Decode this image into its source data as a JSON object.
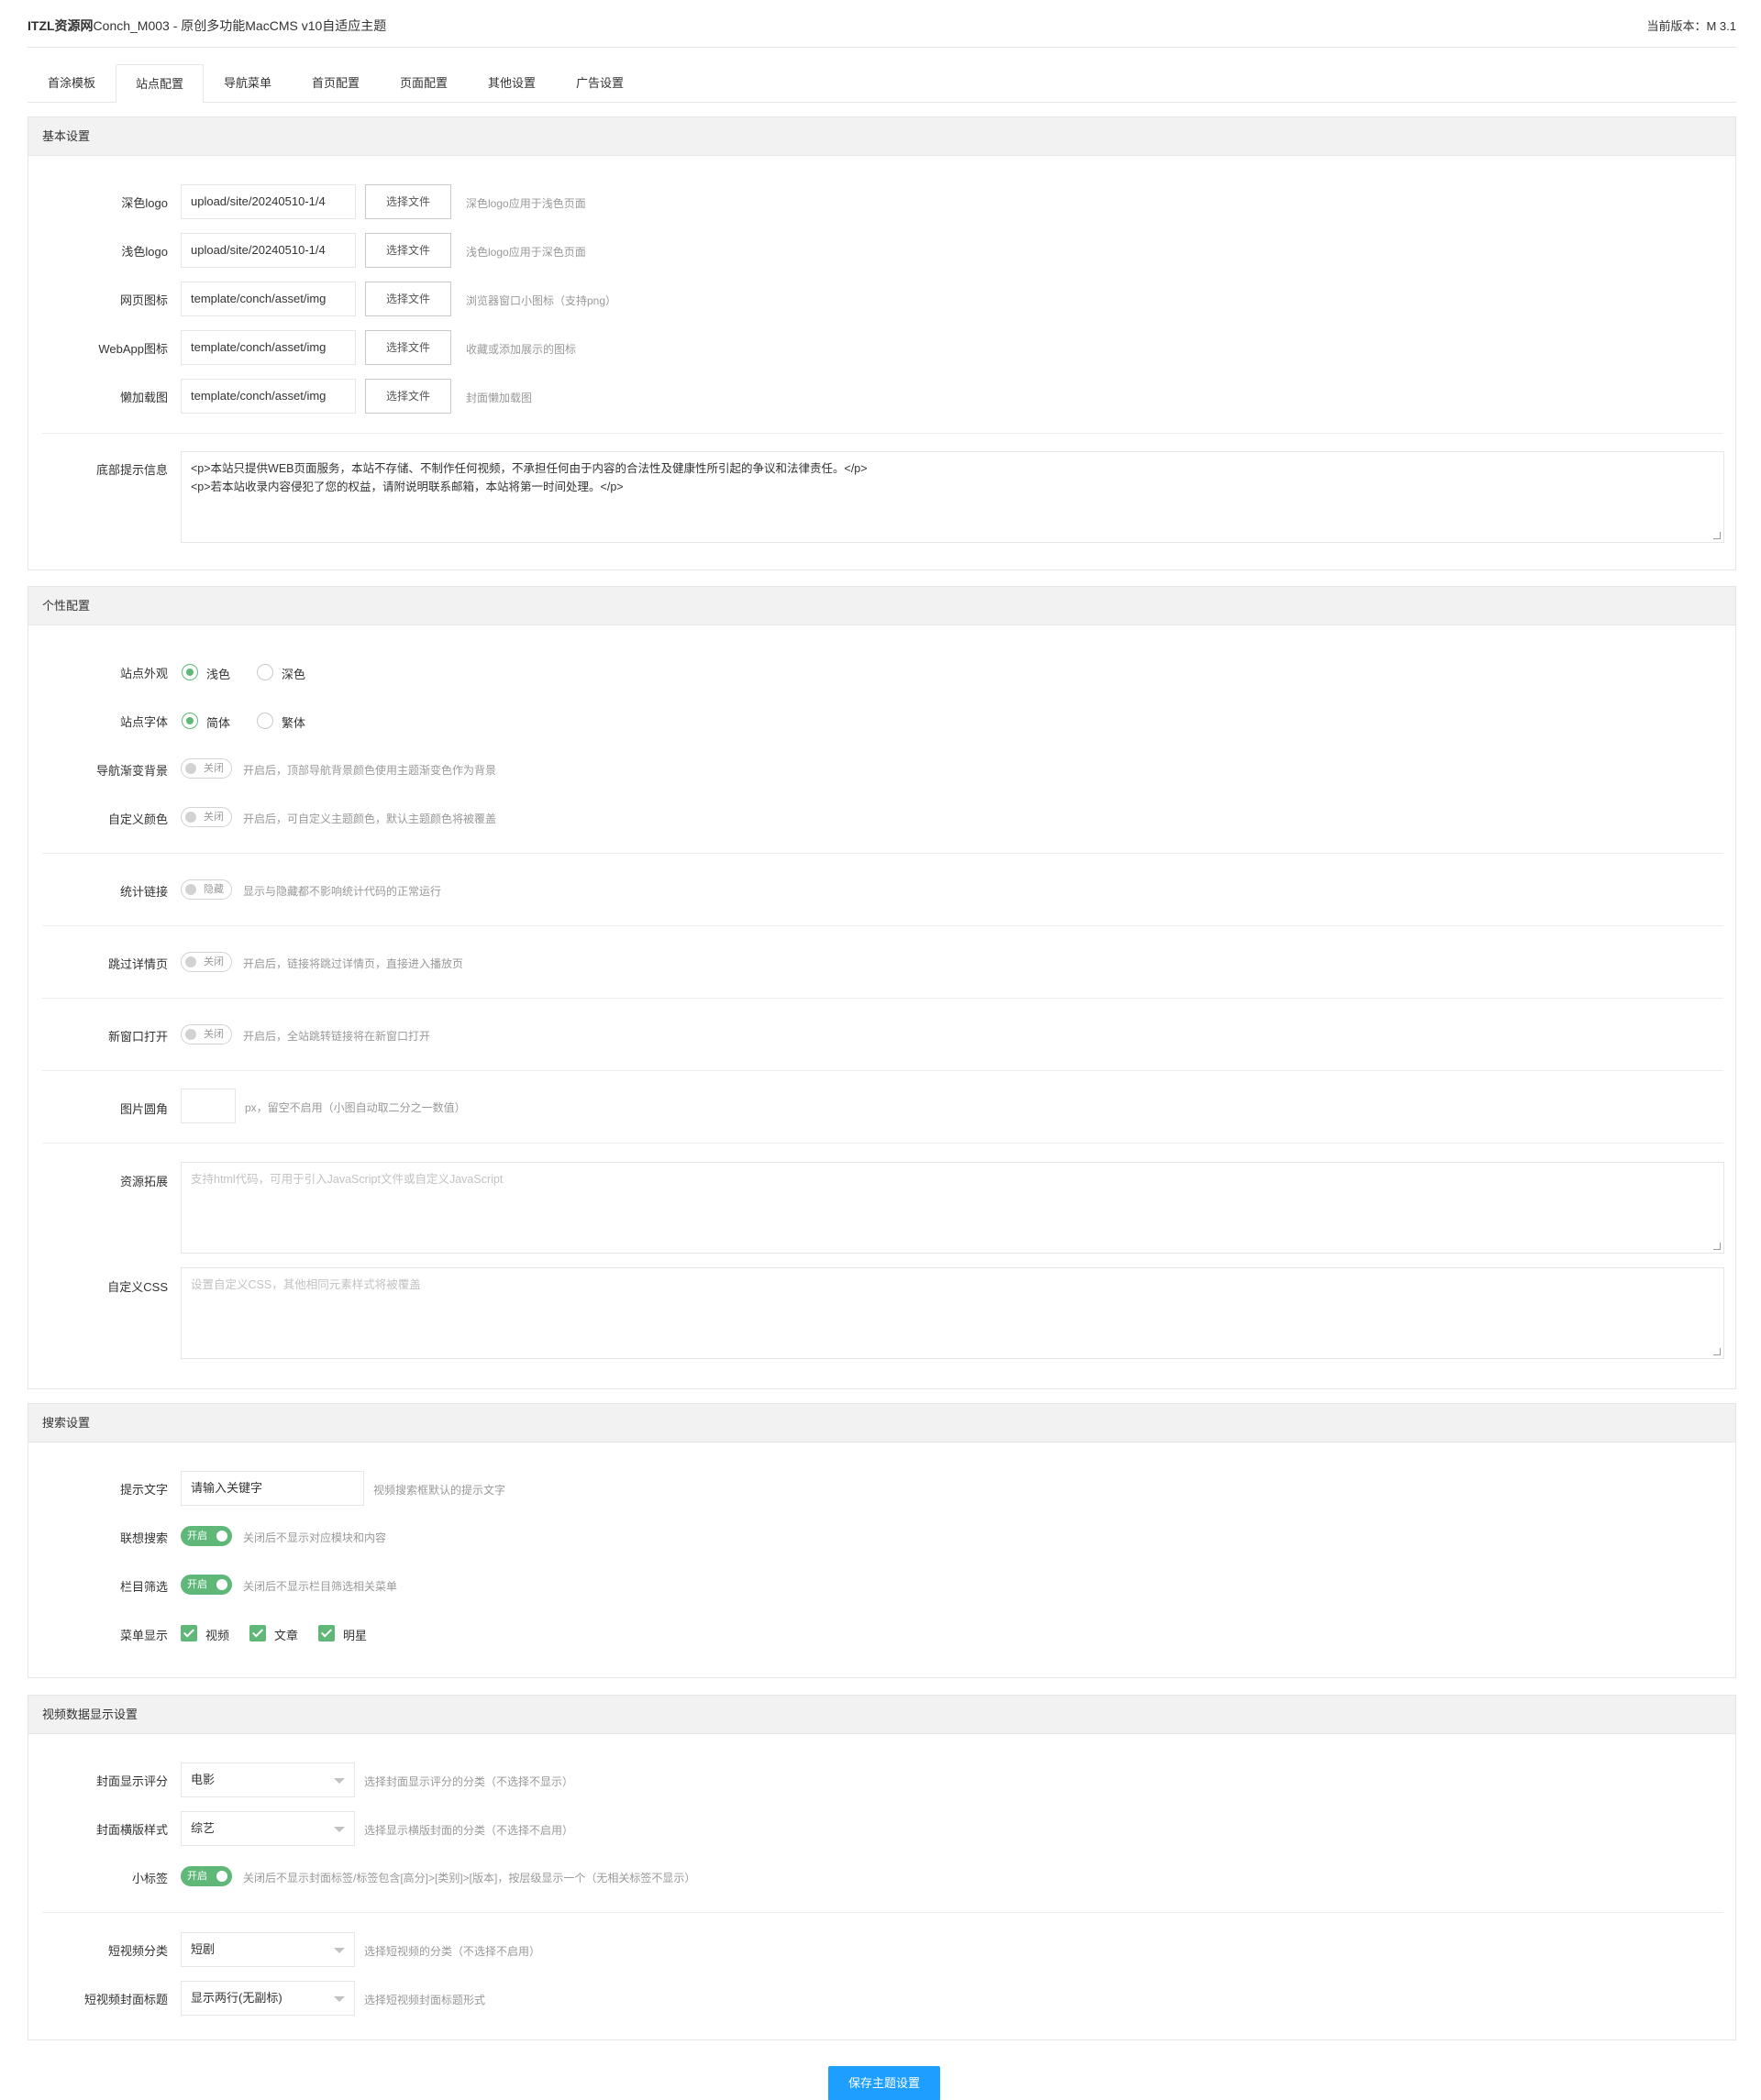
{
  "header": {
    "brand_bold": "ITZL资源网",
    "brand_rest": "Conch_M003 - 原创多功能MacCMS v10自适应主题",
    "version": "当前版本：M 3.1"
  },
  "tabs": [
    "首涂模板",
    "站点配置",
    "导航菜单",
    "首页配置",
    "页面配置",
    "其他设置",
    "广告设置"
  ],
  "basic": {
    "title": "基本设置",
    "rows": [
      {
        "label": "深色logo",
        "value": "upload/site/20240510-1/4",
        "button": "选择文件",
        "hint": "深色logo应用于浅色页面"
      },
      {
        "label": "浅色logo",
        "value": "upload/site/20240510-1/4",
        "button": "选择文件",
        "hint": "浅色logo应用于深色页面"
      },
      {
        "label": "网页图标",
        "value": "template/conch/asset/img",
        "button": "选择文件",
        "hint": "浏览器窗口小图标（支持png）"
      },
      {
        "label": "WebApp图标",
        "value": "template/conch/asset/img",
        "button": "选择文件",
        "hint": "收藏或添加展示的图标"
      },
      {
        "label": "懒加载图",
        "value": "template/conch/asset/img",
        "button": "选择文件",
        "hint": "封面懒加载图"
      }
    ],
    "footer_label": "底部提示信息",
    "footer_value": "<p>本站只提供WEB页面服务，本站不存储、不制作任何视频，不承担任何由于内容的合法性及健康性所引起的争议和法律责任。</p>\n<p>若本站收录内容侵犯了您的权益，请附说明联系邮箱，本站将第一时间处理。</p>"
  },
  "personal": {
    "title": "个性配置",
    "appearance": {
      "label": "站点外观",
      "opt1": "浅色",
      "opt2": "深色"
    },
    "font": {
      "label": "站点字体",
      "opt1": "简体",
      "opt2": "繁体"
    },
    "nav_gradient": {
      "label": "导航渐变背景",
      "state": "关闭",
      "hint": "开启后，顶部导航背景颜色使用主题渐变色作为背景"
    },
    "custom_color": {
      "label": "自定义颜色",
      "state": "关闭",
      "hint": "开启后，可自定义主题颜色，默认主题颜色将被覆盖"
    },
    "stats_link": {
      "label": "统计链接",
      "state": "隐藏",
      "hint": "显示与隐藏都不影响统计代码的正常运行"
    },
    "skip_detail": {
      "label": "跳过详情页",
      "state": "关闭",
      "hint": "开启后，链接将跳过详情页，直接进入播放页"
    },
    "new_window": {
      "label": "新窗口打开",
      "state": "关闭",
      "hint": "开启后，全站跳转链接将在新窗口打开"
    },
    "radius": {
      "label": "图片圆角",
      "hint": "px，留空不启用（小图自动取二分之一数值）"
    },
    "resource": {
      "label": "资源拓展",
      "placeholder": "支持html代码，可用于引入JavaScript文件或自定义JavaScript"
    },
    "css": {
      "label": "自定义CSS",
      "placeholder": "设置自定义CSS，其他相同元素样式将被覆盖"
    }
  },
  "search": {
    "title": "搜索设置",
    "hint_text": {
      "label": "提示文字",
      "value": "请输入关键字",
      "hint": "视频搜索框默认的提示文字"
    },
    "suggest": {
      "label": "联想搜索",
      "state": "开启",
      "hint": "关闭后不显示对应模块和内容"
    },
    "filter": {
      "label": "栏目筛选",
      "state": "开启",
      "hint": "关闭后不显示栏目筛选相关菜单"
    },
    "menu": {
      "label": "菜单显示",
      "opt1": "视频",
      "opt2": "文章",
      "opt3": "明星"
    }
  },
  "video": {
    "title": "视频数据显示设置",
    "score": {
      "label": "封面显示评分",
      "value": "电影",
      "hint": "选择封面显示评分的分类（不选择不显示）"
    },
    "landscape": {
      "label": "封面横版样式",
      "value": "综艺",
      "hint": "选择显示横版封面的分类（不选择不启用）"
    },
    "tag": {
      "label": "小标签",
      "state": "开启",
      "hint": "关闭后不显示封面标签/标签包含[高分]>[类别]>[版本]，按层级显示一个（无相关标签不显示）"
    },
    "short_cat": {
      "label": "短视频分类",
      "value": "短剧",
      "hint": "选择短视频的分类（不选择不启用）"
    },
    "short_title": {
      "label": "短视频封面标题",
      "value": "显示两行(无副标)",
      "hint": "选择短视频封面标题形式"
    }
  },
  "save_label": "保存主题设置",
  "colors": {
    "accent": "#5FB878",
    "primary": "#1E9FFF"
  }
}
